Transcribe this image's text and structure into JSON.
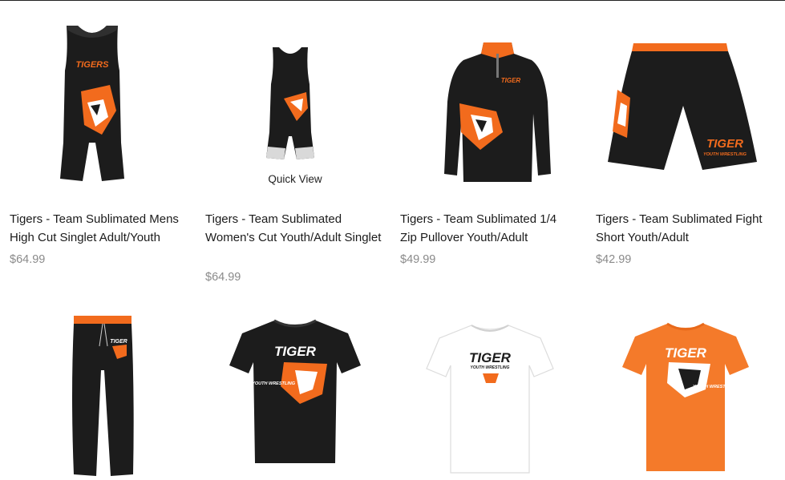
{
  "quick_view_label": "Quick View",
  "brand_colors": {
    "orange": "#f26b1d",
    "black": "#1c1c1c",
    "white": "#ffffff"
  },
  "products": [
    {
      "title": "Tigers - Team Sublimated Mens High Cut Singlet Adult/Youth",
      "price": "$64.99",
      "image": "mens-singlet",
      "print": "TIGERS"
    },
    {
      "title": "Tigers - Team Sublimated Women's Cut Youth/Adult Singlet",
      "price": "$64.99",
      "image": "womens-singlet"
    },
    {
      "title": "Tigers - Team Sublimated 1/4 Zip Pullover Youth/Adult",
      "price": "$49.99",
      "image": "quarter-zip-pullover",
      "print": "TIGER"
    },
    {
      "title": "Tigers - Team Sublimated Fight Short Youth/Adult",
      "price": "$42.99",
      "image": "fight-short",
      "print": "TIGER",
      "print_sub": "YOUTH WRESTLING"
    },
    {
      "title": "",
      "price": "",
      "image": "joggers",
      "print": "TIGER"
    },
    {
      "title": "",
      "price": "",
      "image": "black-tshirt",
      "print": "TIGER",
      "print_sub": "YOUTH WRESTLING"
    },
    {
      "title": "",
      "price": "",
      "image": "white-tshirt",
      "print": "TIGER",
      "print_sub": "YOUTH WRESTLING"
    },
    {
      "title": "",
      "price": "",
      "image": "orange-tshirt",
      "print": "TIGER",
      "print_sub": "YOUTH WRESTLING"
    }
  ]
}
